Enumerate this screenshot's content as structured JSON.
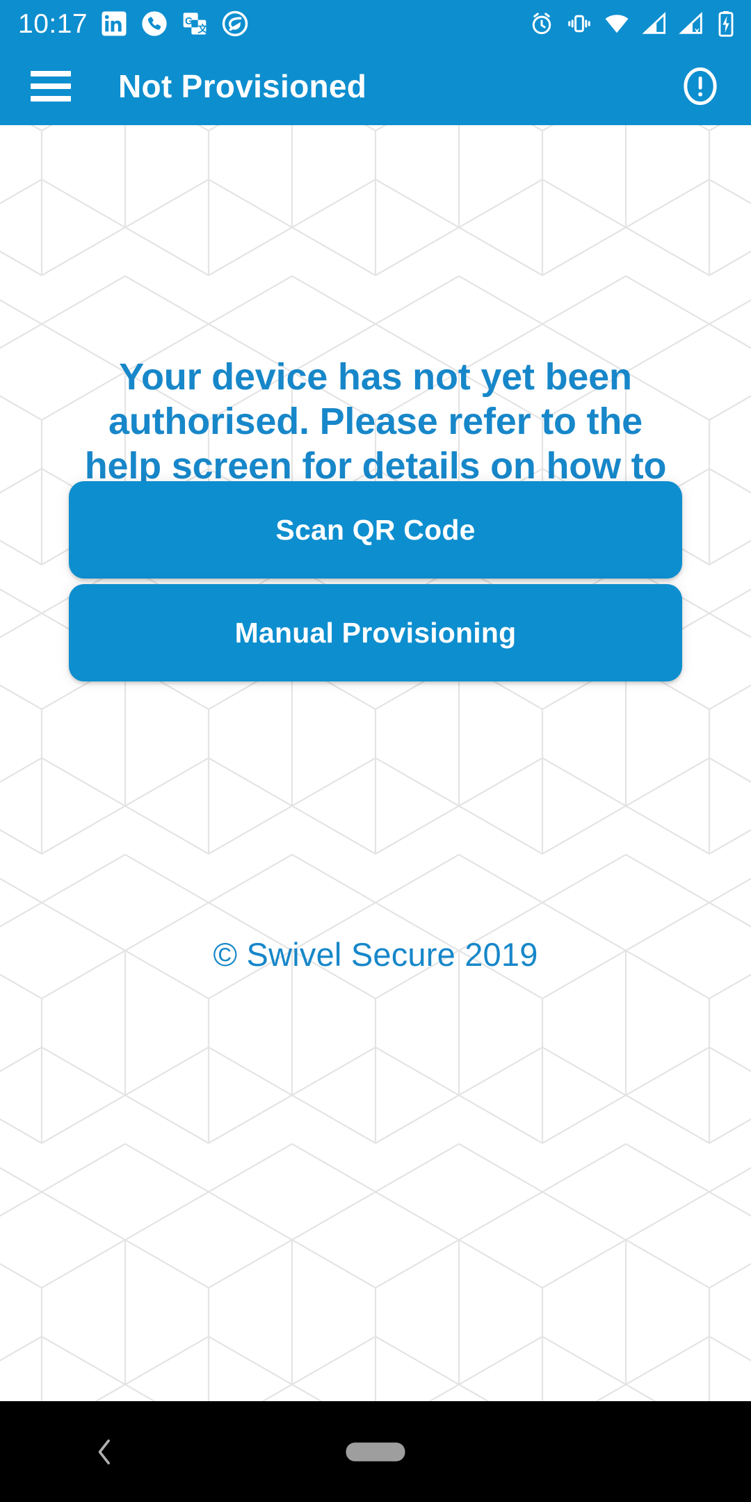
{
  "status_bar": {
    "time": "10:17",
    "left_icons": [
      {
        "name": "linkedin-icon",
        "label": "LinkedIn"
      },
      {
        "name": "phone-call-icon",
        "label": "Call"
      },
      {
        "name": "google-translate-icon",
        "label": "Google Translate"
      },
      {
        "name": "circle-swirl-icon",
        "label": "App notification"
      }
    ],
    "right_icons": [
      {
        "name": "alarm-clock-icon",
        "label": "Alarm set"
      },
      {
        "name": "vibrate-icon",
        "label": "Vibrate mode"
      },
      {
        "name": "wifi-icon",
        "label": "Wi-Fi connected"
      },
      {
        "name": "signal-bars-icon",
        "label": "Mobile signal"
      },
      {
        "name": "signal-no-sim-icon",
        "label": "No SIM signal"
      },
      {
        "name": "battery-charging-icon",
        "label": "Battery charging"
      }
    ]
  },
  "app_bar": {
    "menu_label": "Open navigation menu",
    "title": "Not Provisioned",
    "info_label": "Help information"
  },
  "main": {
    "message": "Your device has not yet been authorised. Please refer to the help screen for details on how to authorise your device.",
    "buttons": [
      {
        "id": "scan-qr",
        "label": "Scan QR Code"
      },
      {
        "id": "manual-provisioning",
        "label": "Manual Provisioning"
      }
    ],
    "footer": "© Swivel Secure 2019"
  },
  "nav_bar": {
    "back_label": "Back",
    "home_label": "Home"
  },
  "colors": {
    "brand_blue": "#0d8ecf",
    "text_blue": "#1787c9",
    "pattern_gray": "#e4e4e4",
    "nav_black": "#000000",
    "nav_pill_gray": "#9e9e9e",
    "white": "#ffffff"
  }
}
